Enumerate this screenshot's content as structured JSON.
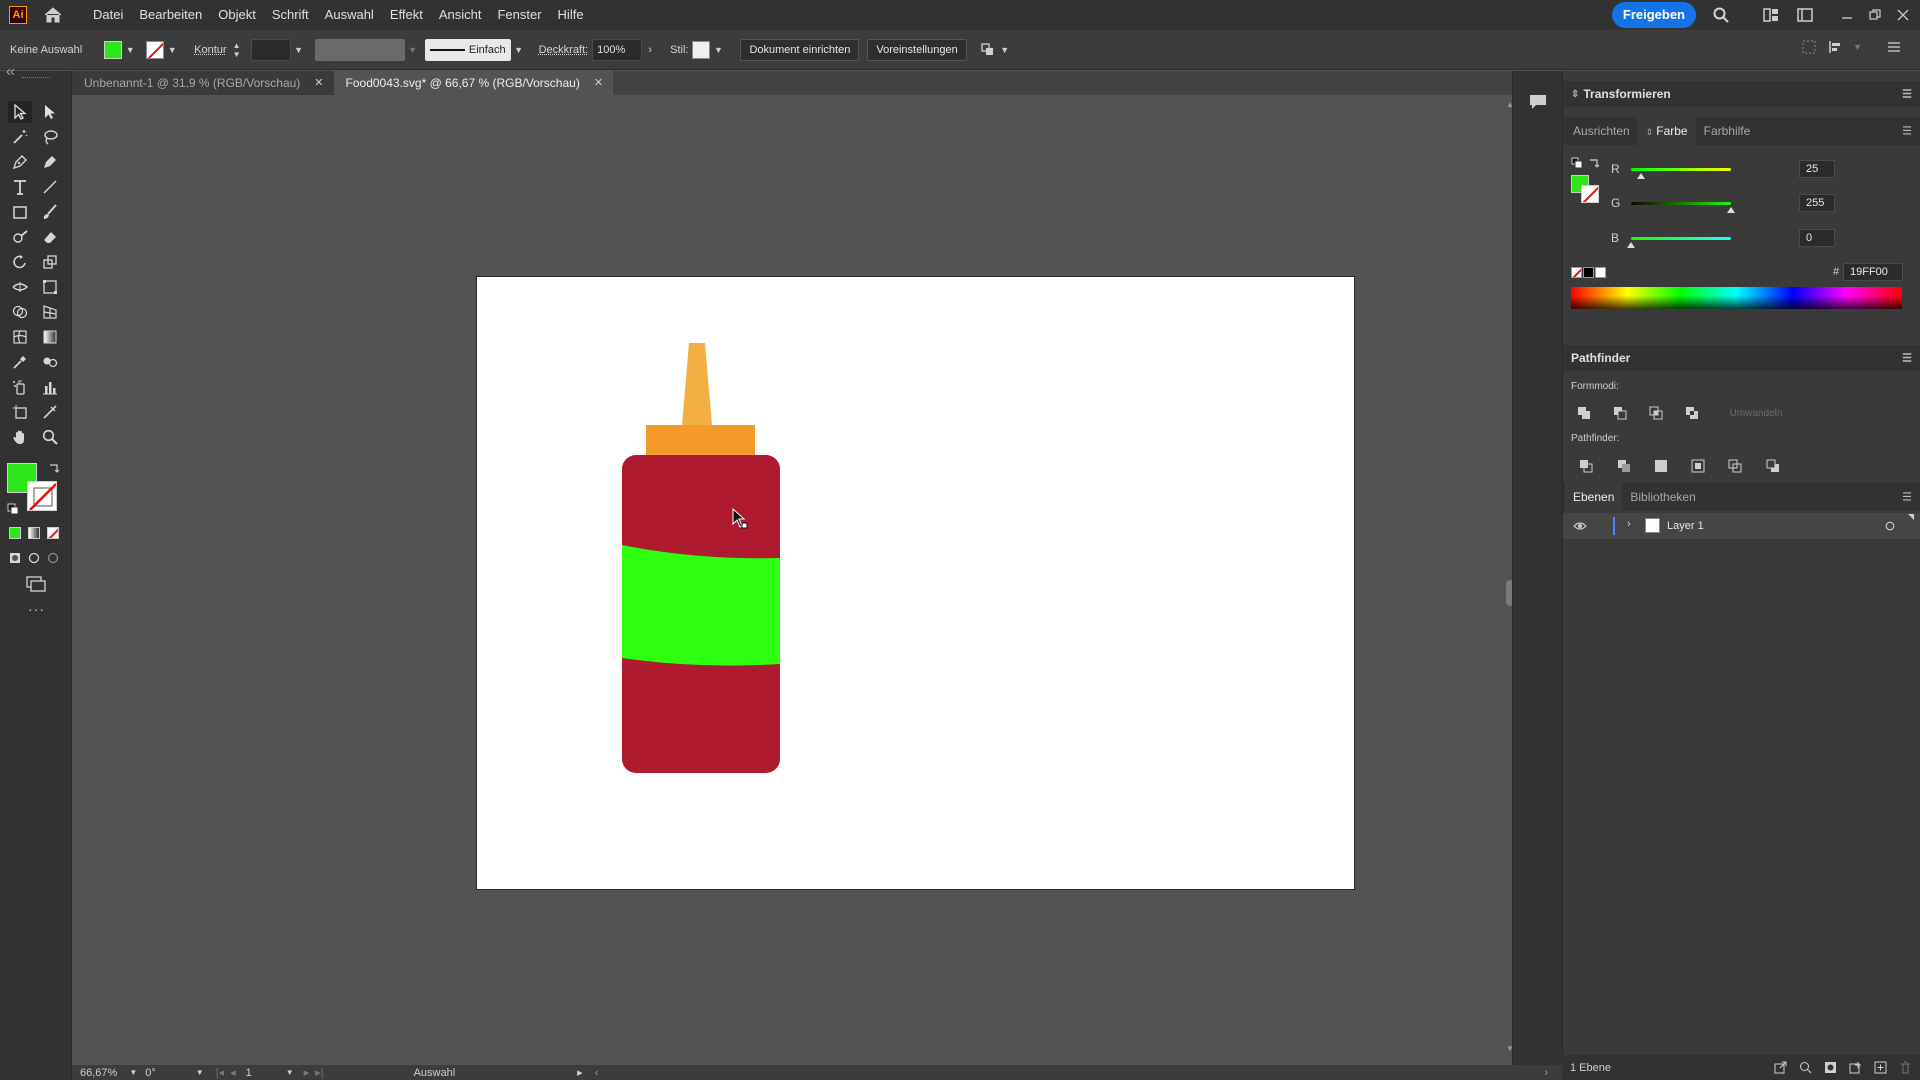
{
  "app": {
    "logo_text": "Ai",
    "menu": [
      "Datei",
      "Bearbeiten",
      "Objekt",
      "Schrift",
      "Auswahl",
      "Effekt",
      "Ansicht",
      "Fenster",
      "Hilfe"
    ],
    "share_label": "Freigeben"
  },
  "control_bar": {
    "selection_label": "Keine Auswahl",
    "fill_color": "#2DE61A",
    "stroke_label": "Kontur",
    "stroke_style_label": "Einfach",
    "opacity_label": "Deckkraft:",
    "opacity_value": "100%",
    "style_label": "Stil:",
    "document_setup_label": "Dokument einrichten",
    "preferences_label": "Voreinstellungen"
  },
  "tabs": [
    {
      "label": "Unbenannt-1 @ 31,9 % (RGB/Vorschau)",
      "active": false
    },
    {
      "label": "Food0043.svg* @ 66,67 % (RGB/Vorschau)",
      "active": true
    }
  ],
  "tool_colors": {
    "fill": "#2DE61A",
    "stroke": "none"
  },
  "artwork": {
    "nozzle_color": "#F3B042",
    "cap_color": "#F39A2B",
    "bottle_color": "#AE1A2F",
    "label_color": "#2CFF10"
  },
  "panels": {
    "transform_title": "Transformieren",
    "color_tabs": [
      "Ausrichten",
      "Farbe",
      "Farbhilfe"
    ],
    "active_color_tab": "Farbe",
    "rgb": [
      {
        "label": "R",
        "value": "25",
        "level": 0.098
      },
      {
        "label": "G",
        "value": "255",
        "level": 1.0
      },
      {
        "label": "B",
        "value": "0",
        "level": 0.0
      }
    ],
    "hex_prefix": "#",
    "hex_value": "19FF00",
    "pathfinder_title": "Pathfinder",
    "shape_modes_label": "Formmodi:",
    "expand_label": "Umwandeln",
    "pathfinders_label": "Pathfinder:",
    "layer_tabs": [
      "Ebenen",
      "Bibliotheken"
    ],
    "active_layer_tab": "Ebenen",
    "layers": [
      {
        "name": "Layer 1"
      }
    ],
    "layer_count": "1 Ebene"
  },
  "status_bar": {
    "zoom": "66,67%",
    "rotation": "0°",
    "artboard_number": "1",
    "tool_name": "Auswahl"
  }
}
